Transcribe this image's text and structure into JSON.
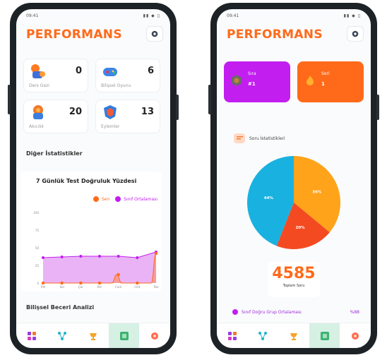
{
  "left_screen": {
    "status_time": "09:41",
    "status_icons": "▮▮ ◆ ▯",
    "brand": "PERFORMANS",
    "stats": [
      {
        "icon": "basketball-kid-icon",
        "value": "0",
        "label": "Ders Gezi"
      },
      {
        "icon": "gamepad-icon",
        "value": "6",
        "label": "Bilişsel Oyunu"
      },
      {
        "icon": "brain-icon",
        "value": "20",
        "label": "Akıcılık"
      },
      {
        "icon": "shield-badge-icon",
        "value": "13",
        "label": "Eylemler"
      }
    ],
    "other_stats_title": "Diğer İstatistikler",
    "chart_section": {
      "title": "7 Günlük Test Doğruluk Yüzdesi",
      "legend": [
        {
          "label": "Sen",
          "color": "#ff6a1a"
        },
        {
          "label": "Sınıf Ortalaması",
          "color": "#c21ef0"
        }
      ]
    },
    "cognitive_title": "Bilişsel Beceri Analizi"
  },
  "right_screen": {
    "status_time": "09:41",
    "status_icons": "▮▮ ◆ ▯",
    "brand": "PERFORMANS",
    "rank_cards": [
      {
        "icon": "hexagon-badge-icon",
        "title": "Sıra",
        "value": "#1",
        "color": "#c21ef0"
      },
      {
        "icon": "flame-icon",
        "title": "Seri",
        "value": "1",
        "color": "#ff6a1a"
      }
    ],
    "soru_title": "Soru İstatistikleri",
    "total_value": "4585",
    "total_label": "Toplam Soru",
    "group_row": {
      "label": "Sınıf Doğru Grup Ortalaması",
      "value": "%88"
    }
  },
  "chart_data": [
    {
      "type": "line",
      "title": "7 Günlük Test Doğruluk Yüzdesi",
      "x": [
        "Pzt",
        "Sal",
        "Çar",
        "Per",
        "Cum",
        "Cmt",
        "Paz"
      ],
      "ylim": [
        0,
        100
      ],
      "y_ticks": [
        "0",
        "25",
        "50",
        "75",
        "100"
      ],
      "series": [
        {
          "name": "Sen",
          "color": "#ff6a1a",
          "values": [
            0,
            0,
            0,
            0,
            12,
            0,
            42
          ],
          "dense_tail_values": [
            0,
            0,
            0,
            0,
            0,
            0,
            0,
            0,
            0,
            0,
            0,
            0,
            0,
            0,
            0,
            12,
            0,
            0,
            0,
            0,
            0,
            0,
            0,
            42
          ]
        },
        {
          "name": "Sınıf Ortalaması",
          "color": "#c21ef0",
          "values": [
            36,
            37,
            38,
            38,
            38,
            36,
            44
          ]
        }
      ],
      "grid": false,
      "legend": "top-right"
    },
    {
      "type": "pie",
      "slices": [
        {
          "label": "44%",
          "value": 44,
          "color": "#19b2e0"
        },
        {
          "label": "36%",
          "value": 36,
          "color": "#ffa31a"
        },
        {
          "label": "20%",
          "value": 20,
          "color": "#f44a21"
        }
      ]
    }
  ]
}
